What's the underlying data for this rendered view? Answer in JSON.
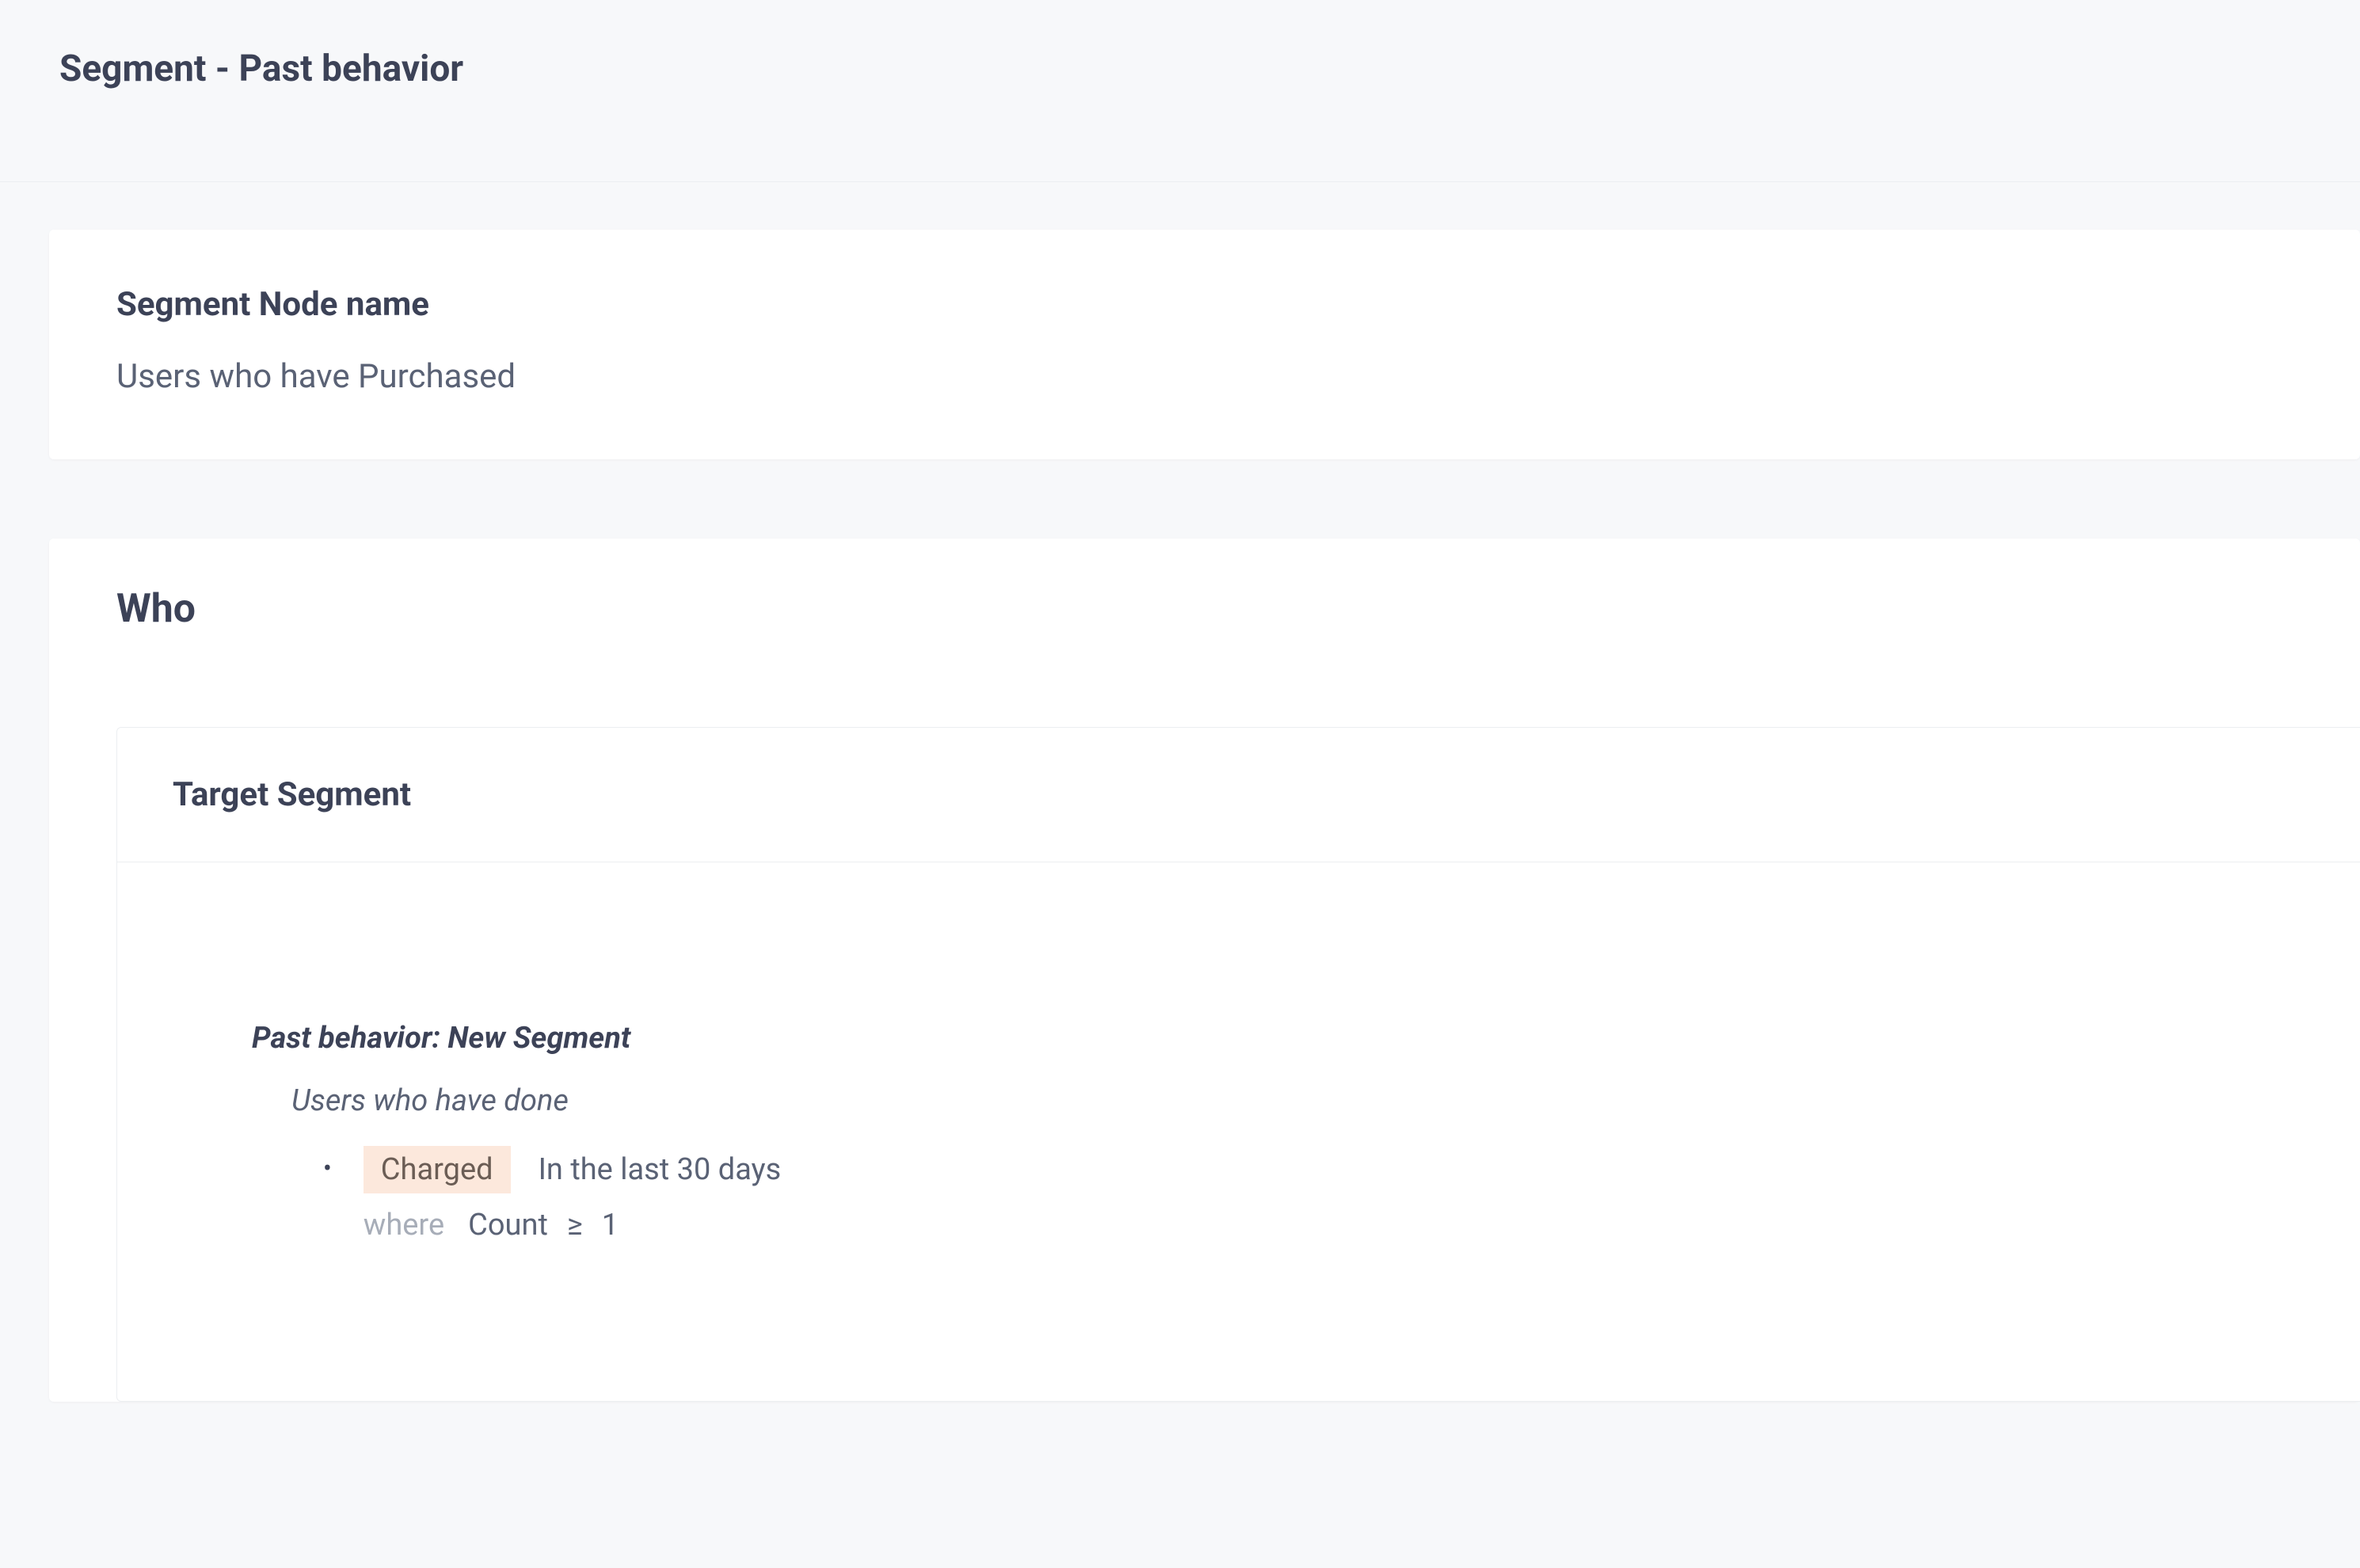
{
  "header": {
    "title": "Segment - Past behavior"
  },
  "node_card": {
    "title": "Segment Node name",
    "value": "Users who have Purchased"
  },
  "who": {
    "title": "Who",
    "target_segment": {
      "title": "Target Segment",
      "past_behavior_label": "Past behavior: New Segment",
      "users_done_label": "Users who have done",
      "rules": [
        {
          "event": "Charged",
          "timeframe": "In the last 30 days",
          "where_label": "where",
          "metric": "Count",
          "operator": "≥",
          "value": "1"
        }
      ]
    }
  }
}
